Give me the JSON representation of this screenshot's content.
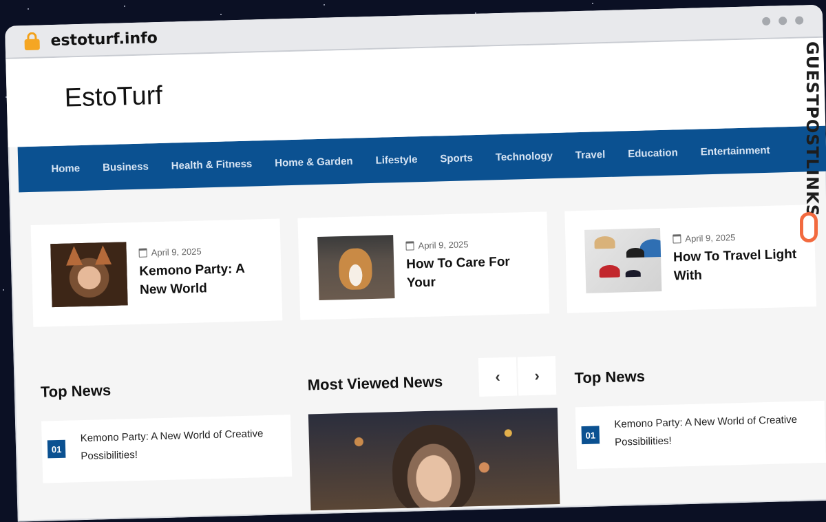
{
  "browser": {
    "url": "estoturf.info"
  },
  "site": {
    "title": "EstoTurf"
  },
  "nav": [
    "Home",
    "Business",
    "Health & Fitness",
    "Home & Garden",
    "Lifestyle",
    "Sports",
    "Technology",
    "Travel",
    "Education",
    "Entertainment"
  ],
  "featured": [
    {
      "date": "April 9, 2025",
      "title": "Kemono Party: A New World"
    },
    {
      "date": "April 9, 2025",
      "title": "How To Care For Your"
    },
    {
      "date": "April 9, 2025",
      "title": "How To Travel Light With"
    }
  ],
  "left": {
    "heading": "Top News",
    "item": {
      "num": "01",
      "text": "Kemono Party: A New World of Creative Possibilities!"
    }
  },
  "middle": {
    "heading": "Most Viewed News",
    "prev": "‹",
    "next": "›"
  },
  "right": {
    "heading": "Top News",
    "item": {
      "num": "01",
      "text": "Kemono Party: A New World of Creative Possibilities!"
    }
  },
  "watermark": {
    "brand": "GUESTPOSTLINKS"
  }
}
